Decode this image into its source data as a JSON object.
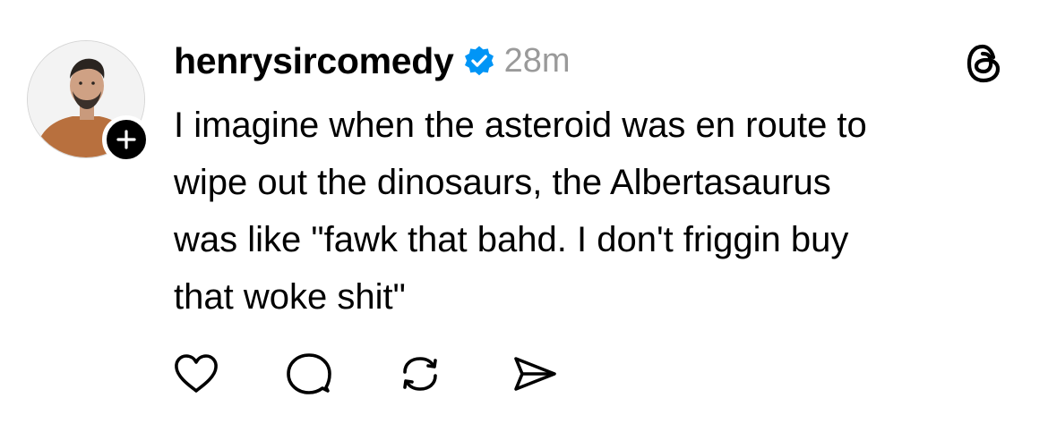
{
  "post": {
    "username": "henrysircomedy",
    "verified": true,
    "time": "28m",
    "text_lines": [
      "I imagine when the asteroid was en route to",
      "wipe out the dinosaurs, the Albertasaurus",
      "was like \"fawk that bahd. I don't friggin buy",
      "that woke shit\""
    ]
  },
  "icons": {
    "avatar": "avatar",
    "follow": "plus-icon",
    "verified": "verified-badge-icon",
    "app": "threads-logo-icon",
    "like": "heart-icon",
    "reply": "comment-bubble-icon",
    "repost": "repost-icon",
    "share": "send-icon"
  },
  "colors": {
    "verified_blue": "#0095f6",
    "timestamp_gray": "#9a9a9a",
    "text": "#000000",
    "background": "#ffffff"
  }
}
